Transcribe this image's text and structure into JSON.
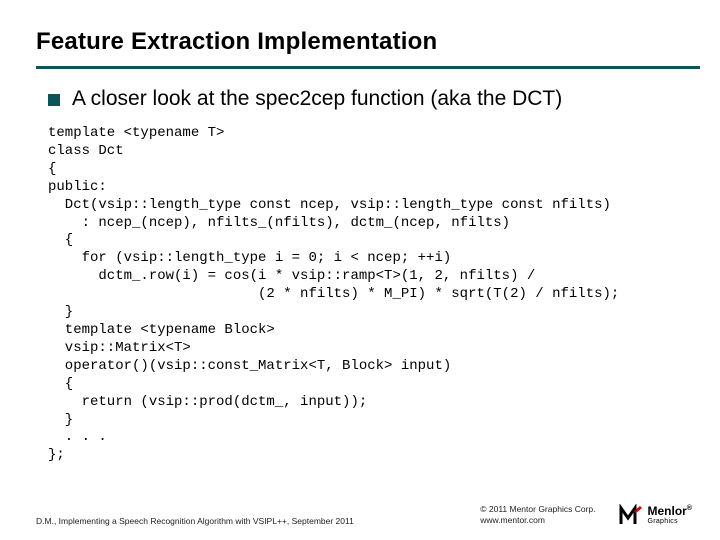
{
  "title": "Feature Extraction Implementation",
  "bullet": "A closer look at the spec2cep function (aka the DCT)",
  "code": "template <typename T>\nclass Dct\n{\npublic:\n  Dct(vsip::length_type const ncep, vsip::length_type const nfilts)\n    : ncep_(ncep), nfilts_(nfilts), dctm_(ncep, nfilts)\n  {\n    for (vsip::length_type i = 0; i < ncep; ++i)\n      dctm_.row(i) = cos(i * vsip::ramp<T>(1, 2, nfilts) /\n                         (2 * nfilts) * M_PI) * sqrt(T(2) / nfilts);\n  }\n  template <typename Block>\n  vsip::Matrix<T>\n  operator()(vsip::const_Matrix<T, Block> input)\n  {\n    return (vsip::prod(dctm_, input));\n  }\n  . . .\n};",
  "footer": {
    "left": "D.M., Implementing a Speech Recognition Algorithm with VSIPL++, September 2011",
    "copyright_line1": "© 2011 Mentor Graphics Corp.",
    "copyright_line2": "www.mentor.com"
  },
  "logo": {
    "name": "Menlor",
    "sub": "Graphics",
    "reg": "®"
  }
}
